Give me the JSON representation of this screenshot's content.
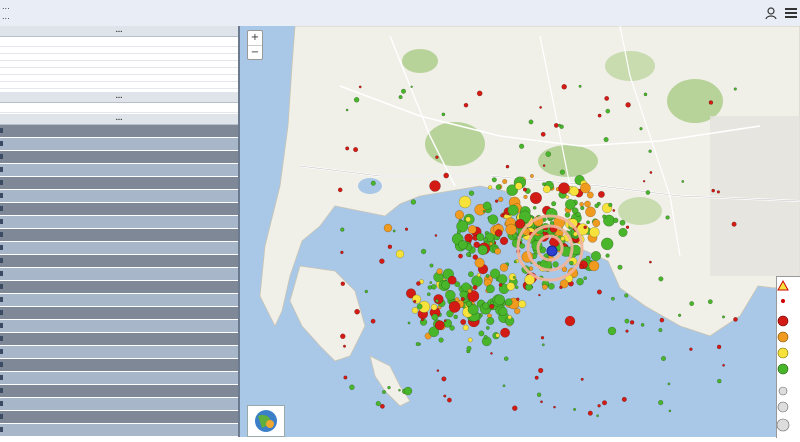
{
  "header": {
    "title": "...",
    "subtitle": "..."
  },
  "panel": {
    "section1_title": "...",
    "section2_title": "...",
    "section3_title": "...",
    "rows": [
      {
        "label": "",
        "value": ""
      },
      {
        "label": "",
        "value": ""
      },
      {
        "label": "",
        "value": ""
      },
      {
        "label": "",
        "value": ""
      },
      {
        "label": "",
        "value": ""
      },
      {
        "label": "",
        "value": ""
      },
      {
        "label": "",
        "value": ""
      },
      {
        "label": "",
        "value": ""
      }
    ],
    "mag_row": {
      "label": "",
      "value": ""
    },
    "events": [
      {
        "time": "",
        "coords": "",
        "mag": ""
      },
      {
        "time": "",
        "coords": "",
        "mag": ""
      },
      {
        "time": "",
        "coords": "",
        "mag": ""
      },
      {
        "time": "",
        "coords": "",
        "mag": ""
      },
      {
        "time": "",
        "coords": "",
        "mag": ""
      },
      {
        "time": "",
        "coords": "",
        "mag": ""
      },
      {
        "time": "",
        "coords": "",
        "mag": ""
      },
      {
        "time": "",
        "coords": "",
        "mag": ""
      },
      {
        "time": "",
        "coords": "",
        "mag": ""
      },
      {
        "time": "",
        "coords": "",
        "mag": ""
      },
      {
        "time": "",
        "coords": "",
        "mag": ""
      },
      {
        "time": "",
        "coords": "",
        "mag": ""
      },
      {
        "time": "",
        "coords": "",
        "mag": ""
      },
      {
        "time": "",
        "coords": "",
        "mag": ""
      },
      {
        "time": "",
        "coords": "",
        "mag": ""
      },
      {
        "time": "",
        "coords": "",
        "mag": ""
      },
      {
        "time": "",
        "coords": "",
        "mag": ""
      },
      {
        "time": "",
        "coords": "",
        "mag": ""
      },
      {
        "time": "",
        "coords": "",
        "mag": ""
      },
      {
        "time": "",
        "coords": "",
        "mag": ""
      },
      {
        "time": "",
        "coords": "",
        "mag": ""
      },
      {
        "time": "",
        "coords": "",
        "mag": ""
      },
      {
        "time": "",
        "coords": "",
        "mag": ""
      },
      {
        "time": "",
        "coords": "",
        "mag": ""
      }
    ]
  },
  "map": {
    "zoom_in": "+",
    "zoom_out": "−",
    "colors": {
      "sea": "#a9c8e8",
      "land": "#f0efe8",
      "green": "#b7d39a",
      "road": "#ffffff",
      "quake_red": "#d21b14",
      "quake_orange": "#f09a20",
      "quake_yellow": "#f6e23a",
      "quake_green": "#49b52a",
      "epicenter": "#2c3fd0"
    },
    "legend_icons": [
      "warning-triangle-icon",
      "quake-dot-red",
      "quake-dot-orange",
      "quake-dot-yellow",
      "quake-dot-green",
      "star-icon"
    ]
  }
}
